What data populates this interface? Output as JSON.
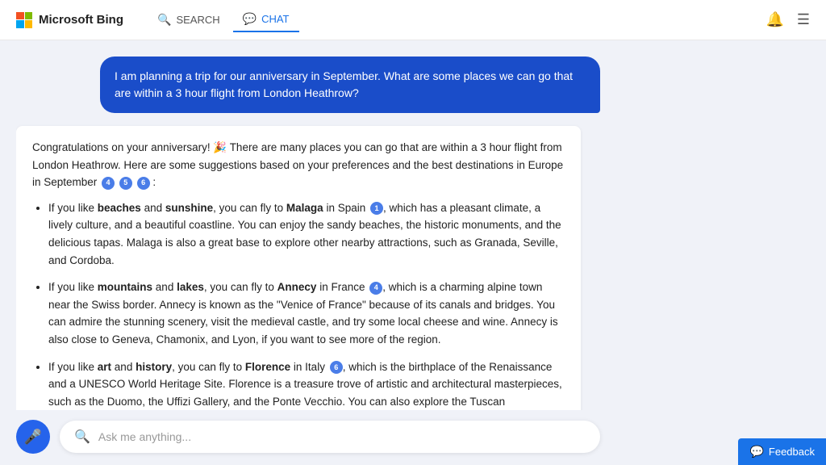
{
  "header": {
    "brand": "Microsoft Bing",
    "nav_search_label": "SEARCH",
    "nav_chat_label": "CHAT"
  },
  "user_message": {
    "text": "I am planning a trip for our anniversary in September. What are some places we can go that are within a 3 hour flight from London Heathrow?"
  },
  "bot_response": {
    "intro": "Congratulations on your anniversary! 🎉 There are many places you can go that are within a 3 hour flight from London Heathrow. Here are some suggestions based on your preferences and the best destinations in Europe in September",
    "intro_cites": [
      "4",
      "5",
      "6"
    ],
    "items": [
      {
        "prefix": "If you like ",
        "bold1": "beaches",
        "mid1": " and ",
        "bold2": "sunshine",
        "mid2": ", you can fly to ",
        "bold3": "Malaga",
        "suffix": " in Spain",
        "cite": "1",
        "detail": ", which has a pleasant climate, a lively culture, and a beautiful coastline. You can enjoy the sandy beaches, the historic monuments, and the delicious tapas. Malaga is also a great base to explore other nearby attractions, such as Granada, Seville, and Cordoba."
      },
      {
        "prefix": "If you like ",
        "bold1": "mountains",
        "mid1": " and ",
        "bold2": "lakes",
        "mid2": ", you can fly to ",
        "bold3": "Annecy",
        "suffix": " in France",
        "cite": "4",
        "detail": ", which is a charming alpine town near the Swiss border. Annecy is known as the \"Venice of France\" because of its canals and bridges. You can admire the stunning scenery, visit the medieval castle, and try some local cheese and wine. Annecy is also close to Geneva, Chamonix, and Lyon, if you want to see more of the region."
      },
      {
        "prefix": "If you like ",
        "bold1": "art",
        "mid1": " and ",
        "bold2": "history",
        "mid2": ", you can fly to ",
        "bold3": "Florence",
        "suffix": " in Italy",
        "cite": "6",
        "detail": ", which is the birthplace of the Renaissance and a UNESCO World Heritage Site. Florence is a treasure trove of artistic and architectural masterpieces, such as the Duomo, the Uffizi Gallery, and the Ponte Vecchio. You can also explore the Tuscan countryside, taste the famous gelato, and shop for leather goods."
      }
    ]
  },
  "input": {
    "placeholder": "Ask me anything..."
  },
  "feedback": {
    "label": "Feedback"
  }
}
